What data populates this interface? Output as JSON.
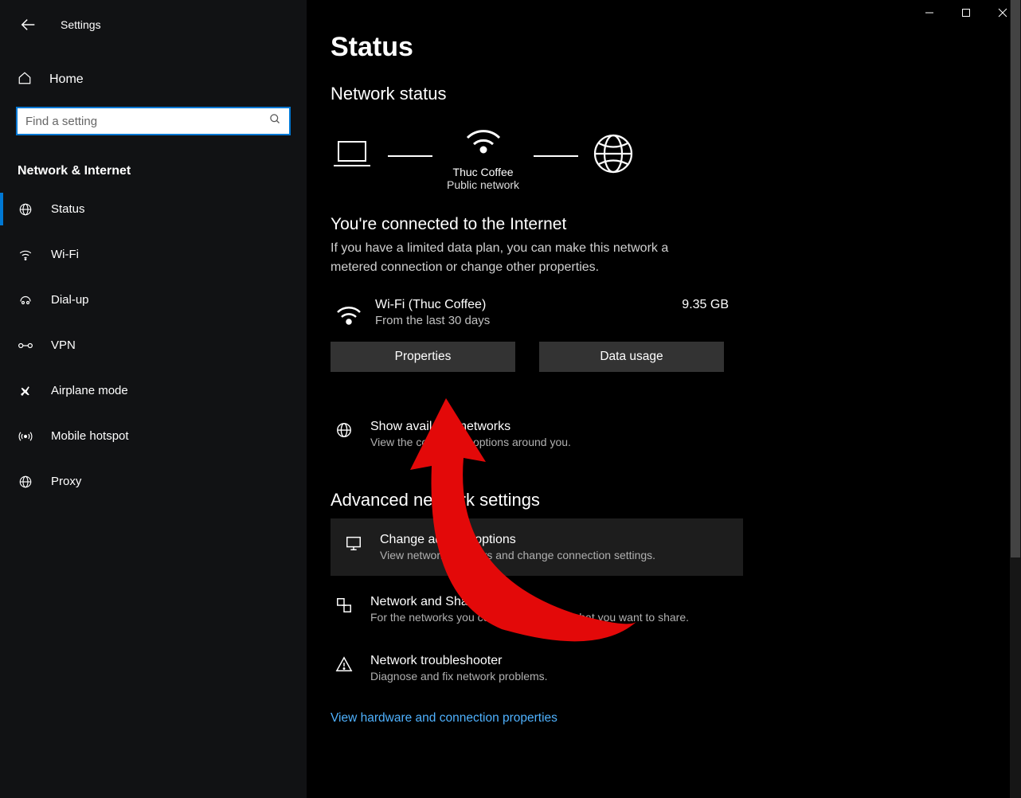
{
  "window": {
    "title": "Settings"
  },
  "sidebar": {
    "home": "Home",
    "search_placeholder": "Find a setting",
    "category": "Network & Internet",
    "items": [
      {
        "label": "Status",
        "icon": "globe"
      },
      {
        "label": "Wi-Fi",
        "icon": "wifi"
      },
      {
        "label": "Dial-up",
        "icon": "dialup"
      },
      {
        "label": "VPN",
        "icon": "vpn"
      },
      {
        "label": "Airplane mode",
        "icon": "airplane"
      },
      {
        "label": "Mobile hotspot",
        "icon": "hotspot"
      },
      {
        "label": "Proxy",
        "icon": "globe"
      }
    ]
  },
  "main": {
    "title": "Status",
    "network_status_heading": "Network status",
    "diagram": {
      "network_name": "Thuc Coffee",
      "network_type": "Public network"
    },
    "connected_heading": "You're connected to the Internet",
    "connected_desc": "If you have a limited data plan, you can make this network a metered connection or change other properties.",
    "wifi": {
      "title": "Wi-Fi (Thuc Coffee)",
      "subtitle": "From the last 30 days",
      "data_used": "9.35 GB"
    },
    "buttons": {
      "properties": "Properties",
      "data_usage": "Data usage"
    },
    "show_networks": {
      "title": "Show available networks",
      "desc": "View the connection options around you."
    },
    "advanced_heading": "Advanced network settings",
    "adapter": {
      "title": "Change adapter options",
      "desc": "View network adapters and change connection settings."
    },
    "sharing": {
      "title": "Network and Sharing Center",
      "desc": "For the networks you connect to, decide what you want to share."
    },
    "troubleshoot": {
      "title": "Network troubleshooter",
      "desc": "Diagnose and fix network problems."
    },
    "hardware_link": "View hardware and connection properties"
  }
}
